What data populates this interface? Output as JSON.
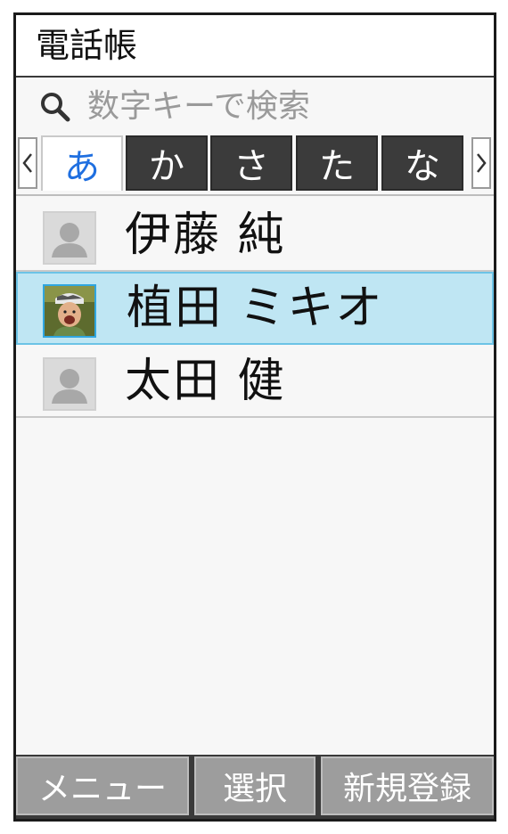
{
  "header": {
    "title": "電話帳"
  },
  "search": {
    "placeholder": "数字キーで検索",
    "icon": "search-icon"
  },
  "tabs": {
    "items": [
      {
        "label": "あ",
        "active": true
      },
      {
        "label": "か",
        "active": false
      },
      {
        "label": "さ",
        "active": false
      },
      {
        "label": "た",
        "active": false
      },
      {
        "label": "な",
        "active": false
      }
    ],
    "prev_icon": "chevron-left-icon",
    "next_icon": "chevron-right-icon"
  },
  "contacts": [
    {
      "name": "伊藤 純",
      "avatar": "default-person-icon",
      "selected": false
    },
    {
      "name": "植田 ミキオ",
      "avatar": "photo",
      "selected": true
    },
    {
      "name": "太田 健",
      "avatar": "default-person-icon",
      "selected": false
    }
  ],
  "softkeys": {
    "left": "メニュー",
    "center": "選択",
    "right": "新規登録"
  },
  "colors": {
    "accent": "#1f6fe0",
    "selected_bg": "#bfe6f3",
    "tab_dark": "#3b3b3b",
    "softkey_bg": "#9d9d9d"
  }
}
